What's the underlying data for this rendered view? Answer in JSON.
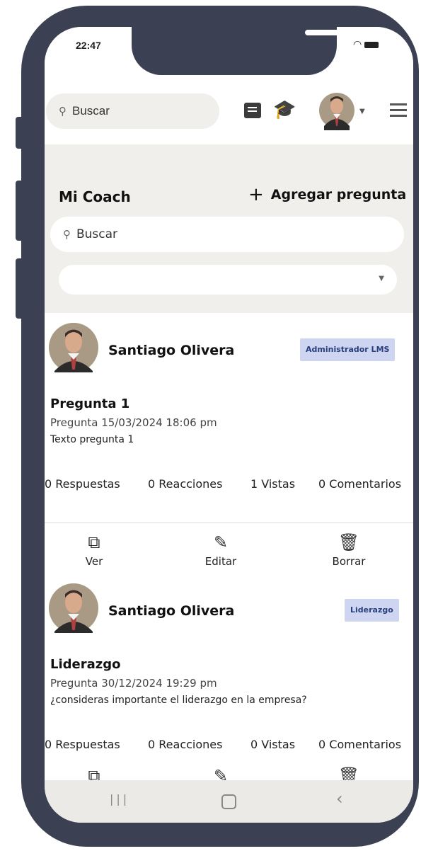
{
  "status": {
    "time": "22:47"
  },
  "topbar": {
    "search_placeholder": "Buscar"
  },
  "icons": [
    "search-icon",
    "chat-icon",
    "graduation-cap-icon",
    "avatar",
    "chevron-down-icon",
    "menu-icon"
  ],
  "coach": {
    "title": "Mi Coach",
    "add_label": "Agregar pregunta",
    "search_placeholder": "Buscar",
    "filter_value": ""
  },
  "questions": [
    {
      "author": "Santiago Olivera",
      "badge": "Administrador LMS",
      "title": "Pregunta 1",
      "meta": "Pregunta 15/03/2024 18:06 pm",
      "text": "Texto pregunta 1",
      "stats": {
        "answers": "0 Respuestas",
        "reactions": "0 Reacciones",
        "views": "1 Vistas",
        "comments": "0 Comentarios"
      },
      "actions": {
        "view": "Ver",
        "edit": "Editar",
        "delete": "Borrar"
      }
    },
    {
      "author": "Santiago Olivera",
      "badge": "Liderazgo",
      "title": "Liderazgo",
      "meta": "Pregunta 30/12/2024 19:29 pm",
      "text": "¿consideras importante el liderazgo en la empresa?",
      "stats": {
        "answers": "0 Respuestas",
        "reactions": "0 Reacciones",
        "views": "0 Vistas",
        "comments": "0 Comentarios"
      }
    }
  ],
  "colors": {
    "frame": "#3b4052",
    "badge_bg": "#cdd5f0",
    "background": "#f1efec"
  }
}
